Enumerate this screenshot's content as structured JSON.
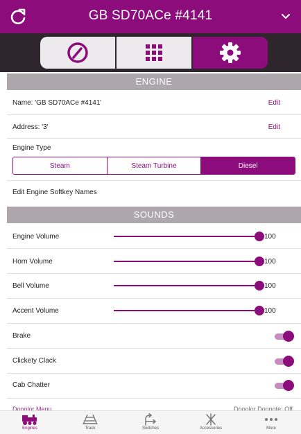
{
  "header": {
    "title": "GB SD70ACe #4141"
  },
  "segments": [
    {
      "icon": "speedometer-icon",
      "selected": false
    },
    {
      "icon": "keypad-grid-icon",
      "selected": false
    },
    {
      "icon": "gear-icon",
      "selected": true
    }
  ],
  "engine_section": {
    "header": "ENGINE",
    "name_label": "Name: 'GB SD70ACe #4141'",
    "address_label": "Address: '3'",
    "edit_label": "Edit",
    "engine_type_label": "Engine Type",
    "engine_types": [
      "Steam",
      "Steam Turbine",
      "Diesel"
    ],
    "selected_type": "Diesel",
    "softkey_label": "Edit Engine Softkey Names"
  },
  "sounds_section": {
    "header": "SOUNDS",
    "sliders": [
      {
        "label": "Engine Volume",
        "value": 100
      },
      {
        "label": "Horn Volume",
        "value": 100
      },
      {
        "label": "Bell Volume",
        "value": 100
      },
      {
        "label": "Accent Volume",
        "value": 100
      }
    ],
    "toggles": [
      {
        "label": "Brake",
        "on": true
      },
      {
        "label": "Clickety Clack",
        "on": true
      },
      {
        "label": "Cab Chatter",
        "on": true
      }
    ],
    "partial_left": "Dooolor Menu",
    "partial_right": "Dooolor Donnote: Off"
  },
  "tabbar": {
    "tabs": [
      {
        "label": "Engines",
        "icon": "locomotive-icon",
        "active": true
      },
      {
        "label": "Track",
        "icon": "track-icon",
        "active": false
      },
      {
        "label": "Switches",
        "icon": "switch-icon",
        "active": false
      },
      {
        "label": "Accessories",
        "icon": "accessories-icon",
        "active": false
      },
      {
        "label": "More",
        "icon": "more-dots-icon",
        "active": false
      }
    ]
  },
  "colors": {
    "accent": "#8c0c7c",
    "dark": "#2e262c",
    "section": "#ada7ac"
  }
}
